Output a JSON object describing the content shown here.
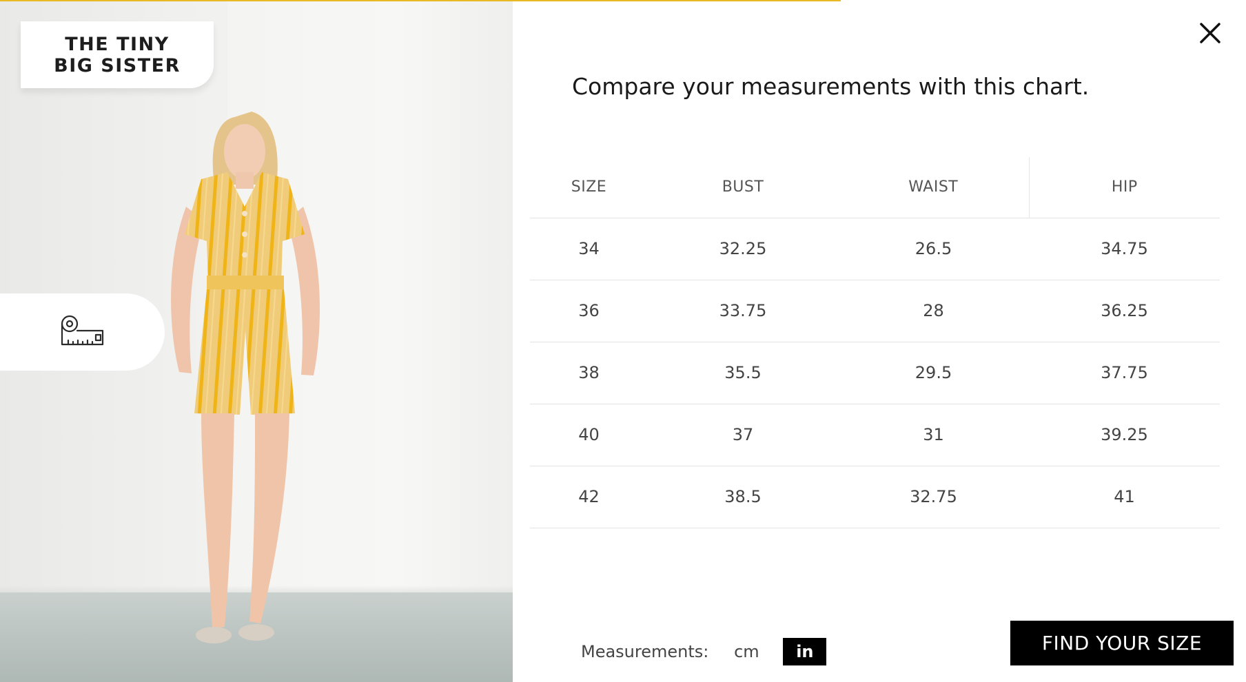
{
  "brand": {
    "line1": "THE TINY",
    "line2": "BIG SISTER"
  },
  "heading": "Compare your measurements with this chart.",
  "table": {
    "headers": [
      "SIZE",
      "BUST",
      "WAIST",
      "HIP"
    ],
    "rows": [
      [
        "34",
        "32.25",
        "26.5",
        "34.75"
      ],
      [
        "36",
        "33.75",
        "28",
        "36.25"
      ],
      [
        "38",
        "35.5",
        "29.5",
        "37.75"
      ],
      [
        "40",
        "37",
        "31",
        "39.25"
      ],
      [
        "42",
        "38.5",
        "32.75",
        "41"
      ]
    ]
  },
  "units": {
    "label": "Measurements:",
    "options": [
      "cm",
      "in"
    ],
    "selected": "in"
  },
  "cta_label": "FIND YOUR SIZE",
  "icons": {
    "close": "close-icon",
    "measure": "measuring-tape-icon"
  },
  "colors": {
    "accent": "#e8b923",
    "button": "#000000",
    "button_text": "#ffffff"
  }
}
